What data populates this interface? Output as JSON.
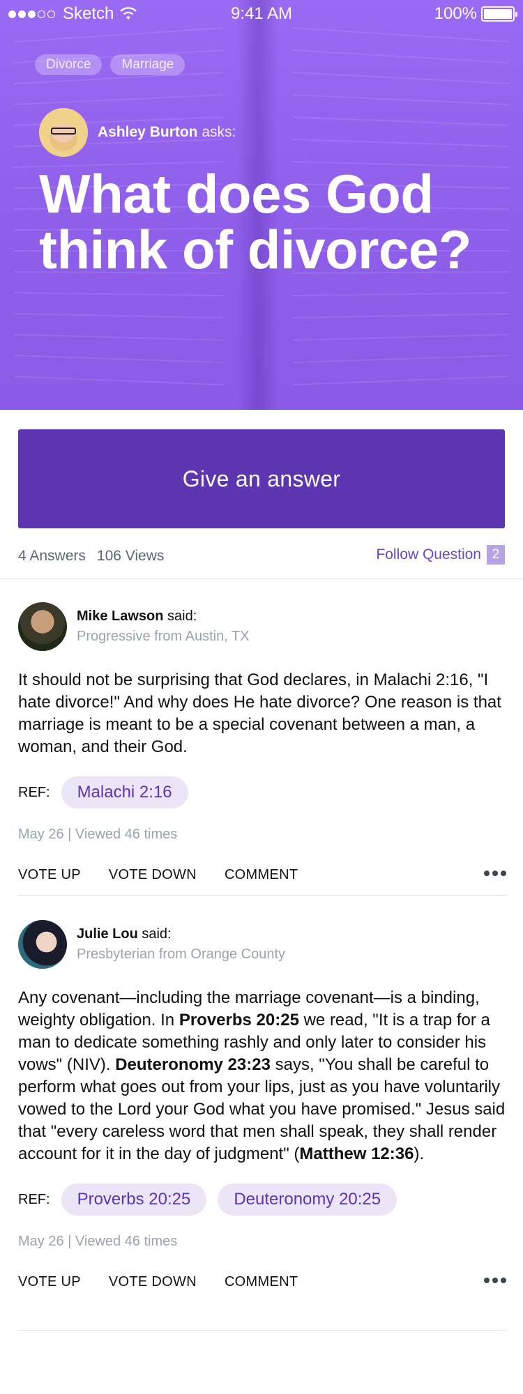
{
  "status_bar": {
    "carrier": "Sketch",
    "time": "9:41 AM",
    "battery": "100%"
  },
  "question": {
    "tags": [
      "Divorce",
      "Marriage"
    ],
    "asker_name": "Ashley Burton",
    "asker_verb": "asks:",
    "title": "What does God think of divorce?"
  },
  "cta": {
    "label": "Give an answer"
  },
  "stats": {
    "answers": "4 Answers",
    "views": "106 Views",
    "follow_label": "Follow Question",
    "follow_count": "2"
  },
  "answers": [
    {
      "name": "Mike Lawson",
      "said": "said:",
      "subtitle": "Progressive from Austin, TX",
      "body": "It should not be surprising that God declares, in Malachi 2:16, \"I hate divorce!\" And why does He hate divorce? One reason is that marriage is meant to be a special covenant between a man, a woman, and their God.",
      "ref_label": "REF:",
      "refs": [
        "Malachi 2:16"
      ],
      "meta": "May 26 | Viewed 46 times",
      "actions": [
        "VOTE UP",
        "VOTE DOWN",
        "COMMENT"
      ]
    },
    {
      "name": "Julie Lou",
      "said": "said:",
      "subtitle": "Presbyterian from Orange County",
      "body_parts": [
        "Any covenant—including the marriage covenant—is a binding, weighty obligation. In ",
        "Proverbs 20:25",
        " we read, \"It is a trap for a man to dedicate something rashly and only later to consider his vows\" (NIV). ",
        "Deuteronomy 23:23",
        " says, \"You shall be careful to perform what goes out from your lips, just as you have voluntarily vowed to the Lord your God what you have promised.\" Jesus said that \"every careless word that men shall speak, they shall render account for it in the day of judgment\" (",
        "Matthew 12:36",
        ")."
      ],
      "ref_label": "REF:",
      "refs": [
        "Proverbs 20:25",
        "Deuteronomy 20:25"
      ],
      "meta": "May 26 | Viewed 46 times",
      "actions": [
        "VOTE UP",
        "VOTE DOWN",
        "COMMENT"
      ]
    }
  ],
  "colors": {
    "hero_purple": "#9a6af2",
    "cta_purple": "#5d35b1",
    "chip_bg": "#ece5f8",
    "muted_text": "#9aa4ae"
  }
}
